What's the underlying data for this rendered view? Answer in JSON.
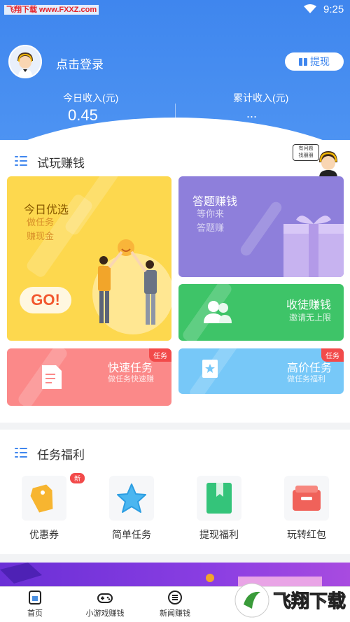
{
  "statusbar": {
    "watermark": "飞翔下载 www.FXXZ.com",
    "time": "9:25"
  },
  "header": {
    "login_text": "点击登录",
    "withdraw_label": "提现",
    "today_income_label": "今日收入(元)",
    "today_income_value": "0.45",
    "total_income_label": "累计收入(元)",
    "total_income_value": "..."
  },
  "trial_section": {
    "title": "试玩赚钱",
    "helper_text": [
      "有问题",
      "找朋朋"
    ],
    "tiles": {
      "featured": {
        "title": "今日优选",
        "sub1": "做任务",
        "sub2": "赚现金",
        "go": "GO!"
      },
      "quiz": {
        "title": "答题赚钱",
        "sub1": "等你来",
        "sub2": "答题赚"
      },
      "invite": {
        "title": "收徒赚钱",
        "sub": "邀请无上限"
      },
      "quick": {
        "title": "快速任务",
        "sub": "做任务快速赚",
        "badge": "任务"
      },
      "premium": {
        "title": "高价任务",
        "sub": "做任务福利",
        "badge": "任务"
      }
    }
  },
  "benefit_section": {
    "title": "任务福利",
    "new_badge": "新",
    "items": [
      {
        "label": "优惠券",
        "icon": "coupon-icon"
      },
      {
        "label": "简单任务",
        "icon": "star-icon"
      },
      {
        "label": "提现福利",
        "icon": "bookmark-icon"
      },
      {
        "label": "玩转红包",
        "icon": "red-envelope-icon"
      }
    ]
  },
  "tabbar": {
    "items": [
      {
        "label": "首页",
        "icon": "home-icon"
      },
      {
        "label": "小游戏赚钱",
        "icon": "gamepad-icon"
      },
      {
        "label": "新闻赚钱",
        "icon": "news-icon"
      }
    ]
  },
  "site_logo_text": "飞翔下载",
  "colors": {
    "primary": "#3f86ee",
    "yellow": "#fdd84e",
    "purple": "#8e7fdb",
    "green": "#3ec468",
    "red": "#fb8989",
    "blue": "#77c8f8"
  }
}
